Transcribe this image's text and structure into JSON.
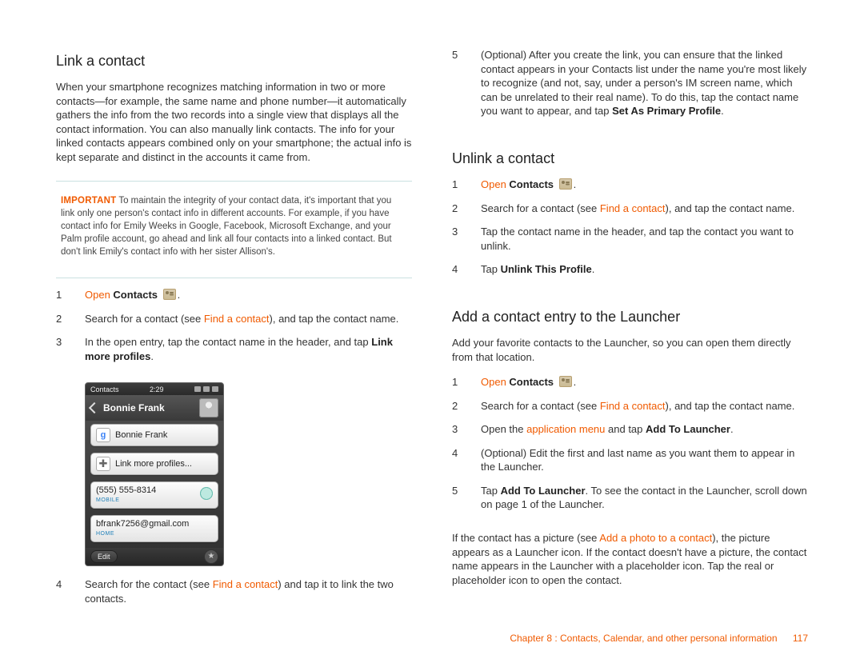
{
  "left": {
    "title": "Link a contact",
    "intro": "When your smartphone recognizes matching information in two or more contacts—for example, the same name and phone number—it automatically gathers the info from the two records into a single view that displays all the contact information. You can also manually link contacts. The info for your linked contacts appears combined only on your smartphone; the actual info is kept separate and distinct in the accounts it came from.",
    "important_lead": "IMPORTANT",
    "important_body": "To maintain the integrity of your contact data, it's important that you link only one person's contact info in different accounts. For example, if you have contact info for Emily Weeks in Google, Facebook, Microsoft Exchange, and your Palm profile account, go ahead and link all four contacts into a linked contact. But don't link Emily's contact info with her sister Allison's.",
    "step1_open": "Open ",
    "step1_contacts": "Contacts",
    "step1_period": ".",
    "step2_a": "Search for a contact (see ",
    "step2_link": "Find a contact",
    "step2_b": "), and tap the contact name.",
    "step3_a": "In the open entry, tap the contact name in the header, and tap ",
    "step3_bold": "Link more profiles",
    "step3_b": ".",
    "step4_a": "Search for the contact (see ",
    "step4_link": "Find a contact",
    "step4_b": ") and tap it to link the two contacts."
  },
  "phone": {
    "status_left": "Contacts",
    "status_time": "2:29",
    "hdr_title": "Bonnie Frank",
    "row1_icon": "g",
    "row1_text": "Bonnie Frank",
    "row2_text": "Link more profiles...",
    "phone_val": "(555) 555-8314",
    "phone_tag": "MOBILE",
    "email_val": "bfrank7256@gmail.com",
    "email_tag": "HOME",
    "edit": "Edit"
  },
  "r1": {
    "step5_a": "(Optional) After you create the link, you can ensure that the linked contact appears in your Contacts list under the name you're most likely to recognize (and not, say, under a person's IM screen name, which can be unrelated to their real name). To do this, tap the contact name you want to appear, and tap ",
    "step5_bold": "Set As Primary Profile",
    "step5_b": "."
  },
  "r2": {
    "title": "Unlink a contact",
    "step1_open": "Open ",
    "step1_contacts": "Contacts",
    "step1_period": ".",
    "step2_a": "Search for a contact (see ",
    "step2_link": "Find a contact",
    "step2_b": "), and tap the contact name.",
    "step3": "Tap the contact name in the header, and tap the contact you want to unlink.",
    "step4_a": "Tap ",
    "step4_bold": "Unlink This Profile",
    "step4_b": "."
  },
  "r3": {
    "title": "Add a contact entry to the Launcher",
    "intro": "Add your favorite contacts to the Launcher, so you can open them directly from that location.",
    "step1_open": "Open ",
    "step1_contacts": "Contacts",
    "step1_period": ".",
    "step2_a": "Search for a contact (see ",
    "step2_link": "Find a contact",
    "step2_b": "), and tap the contact name.",
    "step3_a": "Open the ",
    "step3_link": "application menu",
    "step3_b": " and tap ",
    "step3_bold": "Add To Launcher",
    "step3_c": ".",
    "step4": "(Optional) Edit the first and last name as you want them to appear in the Launcher.",
    "step5_a": "Tap ",
    "step5_bold": "Add To Launcher",
    "step5_b": ". To see the contact in the Launcher, scroll down on page 1 of the Launcher.",
    "closing_a": "If the contact has a picture (see ",
    "closing_link": "Add a photo to a contact",
    "closing_b": "), the picture appears as a Launcher icon. If the contact doesn't have a picture, the contact name appears in the Launcher with a placeholder icon. Tap the real or placeholder icon to open the contact."
  },
  "footer": {
    "chapter": "Chapter 8 : Contacts, Calendar, and other personal information",
    "page": "117"
  }
}
